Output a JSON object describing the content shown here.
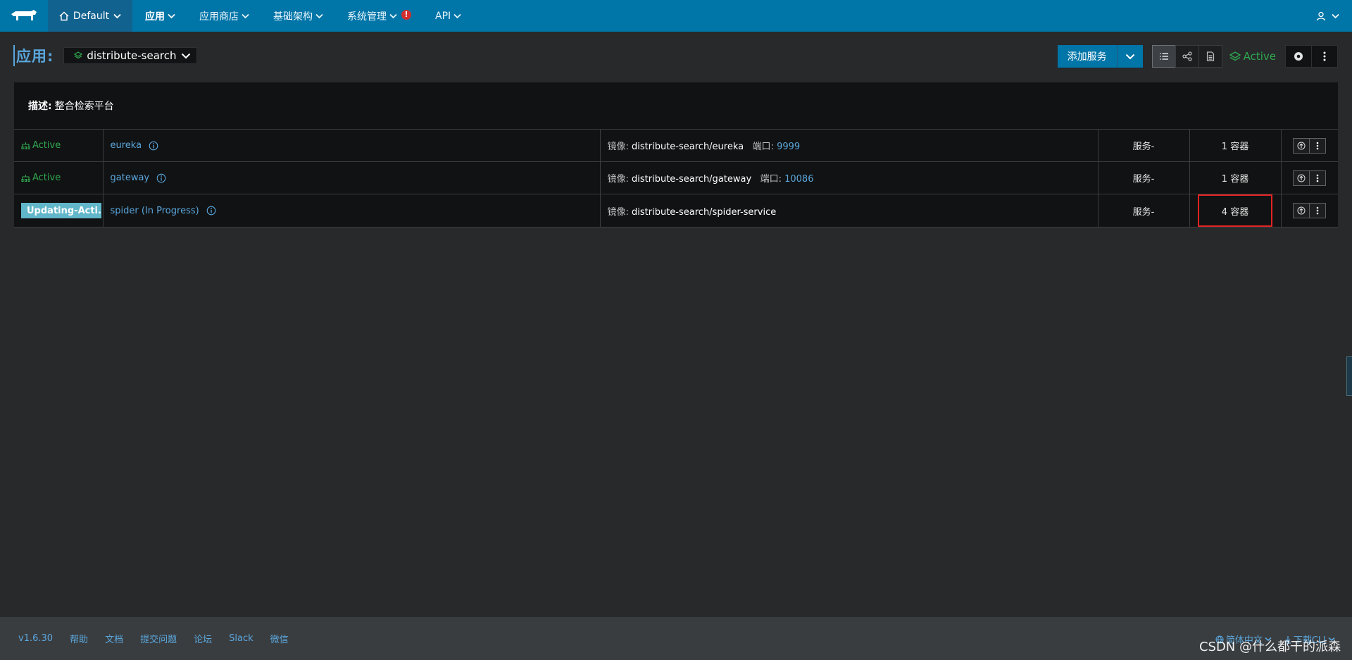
{
  "topnav": {
    "environment": "Default",
    "items": [
      {
        "label": "应用",
        "active": true
      },
      {
        "label": "应用商店"
      },
      {
        "label": "基础架构"
      },
      {
        "label": "系统管理",
        "alert": "!"
      },
      {
        "label": "API"
      }
    ]
  },
  "header": {
    "page_label": "应用:",
    "stack_name": "distribute-search",
    "add_service_label": "添加服务",
    "stack_state": "Active"
  },
  "panel": {
    "desc_label": "描述:",
    "desc_value": "整合检索平台"
  },
  "services": [
    {
      "state": "Active",
      "name": "eureka",
      "image_label": "镜像:",
      "image": "distribute-search/eureka",
      "port_label": "端口:",
      "port": "9999",
      "type": "服务-",
      "scale": "1 容器"
    },
    {
      "state": "Active",
      "name": "gateway",
      "image_label": "镜像:",
      "image": "distribute-search/gateway",
      "port_label": "端口:",
      "port": "10086",
      "type": "服务-",
      "scale": "1 容器"
    },
    {
      "state": "Updating-Acti...",
      "name": "spider (In Progress)",
      "image_label": "镜像:",
      "image": "distribute-search/spider-service",
      "port_label": "",
      "port": "",
      "type": "服务-",
      "scale": "4 容器"
    }
  ],
  "footer": {
    "links": [
      "v1.6.30",
      "帮助",
      "文档",
      "提交问题",
      "论坛",
      "Slack",
      "微信"
    ],
    "language": "简体中文",
    "download": "下载CLI",
    "watermark": "CSDN @什么都干的派森"
  },
  "colors": {
    "nav_bg": "#0075a8",
    "env_bg": "#12628f",
    "active_green": "#2fa84f",
    "link_blue": "#5aa7dd",
    "updating_bg": "#61b6c9",
    "highlight_red": "#e32424"
  }
}
